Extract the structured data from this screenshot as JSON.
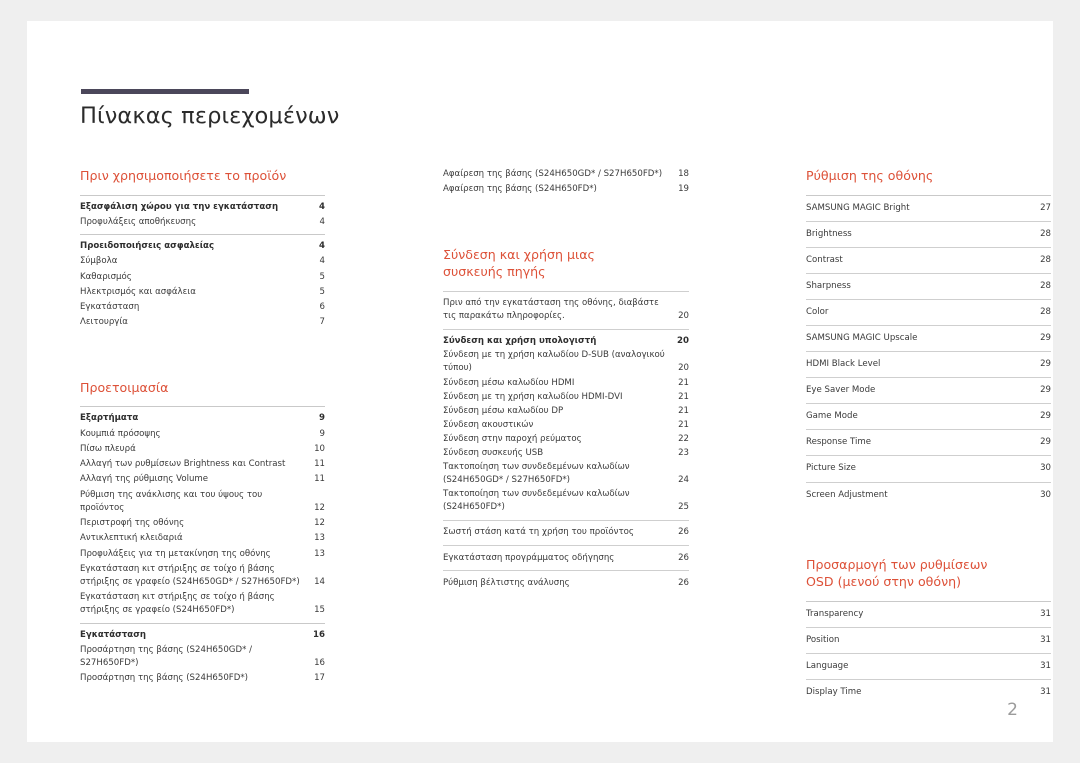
{
  "document": {
    "title": "Πίνακας περιεχομένων",
    "page_number": "2",
    "accent_color": "#dd5138",
    "rule_color": "#4b475a"
  },
  "columns": [
    {
      "id": "column-1",
      "sections": [
        {
          "heading": "Πριν χρησιμοποιήσετε το προϊόν",
          "groups": [
            {
              "style": "plain",
              "rows": [
                {
                  "label": "Εξασφάλιση χώρου για την εγκατάσταση",
                  "page": "4",
                  "bold": true
                },
                {
                  "label": "Προφυλάξεις αποθήκευσης",
                  "page": "4",
                  "bold": false
                }
              ]
            },
            {
              "style": "plain",
              "rows": [
                {
                  "label": "Προειδοποιήσεις ασφαλείας",
                  "page": "4",
                  "bold": true
                },
                {
                  "label": "Σύμβολα",
                  "page": "4",
                  "bold": false
                },
                {
                  "label": "Καθαρισμός",
                  "page": "5",
                  "bold": false
                },
                {
                  "label": "Ηλεκτρισμός και ασφάλεια",
                  "page": "5",
                  "bold": false
                },
                {
                  "label": "Εγκατάσταση",
                  "page": "6",
                  "bold": false
                },
                {
                  "label": "Λειτουργία",
                  "page": "7",
                  "bold": false
                }
              ]
            }
          ]
        },
        {
          "heading": "Προετοιμασία",
          "groups": [
            {
              "style": "plain",
              "rows": [
                {
                  "label": "Εξαρτήματα",
                  "page": "9",
                  "bold": true
                },
                {
                  "label": "Κουμπιά πρόσοψης",
                  "page": "9",
                  "bold": false
                },
                {
                  "label": "Πίσω πλευρά",
                  "page": "10",
                  "bold": false
                },
                {
                  "label": "Αλλαγή των ρυθμίσεων Brightness και Contrast",
                  "page": "11",
                  "bold": false
                },
                {
                  "label": "Αλλαγή της ρύθμισης Volume",
                  "page": "11",
                  "bold": false
                },
                {
                  "label": "Ρύθμιση της ανάκλισης και του ύψους του προϊόντος",
                  "page": "12",
                  "bold": false
                },
                {
                  "label": "Περιστροφή της οθόνης",
                  "page": "12",
                  "bold": false
                },
                {
                  "label": "Αντικλεπτική κλειδαριά",
                  "page": "13",
                  "bold": false
                },
                {
                  "label": "Προφυλάξεις για τη μετακίνηση της οθόνης",
                  "page": "13",
                  "bold": false
                },
                {
                  "label": "Εγκατάσταση κιτ στήριξης σε τοίχο ή βάσης στήριξης σε γραφείο (S24H650GD* / S27H650FD*)",
                  "page": "14",
                  "bold": false
                },
                {
                  "label": "Εγκατάσταση κιτ στήριξης σε τοίχο ή βάσης στήριξης σε γραφείο (S24H650FD*)",
                  "page": "15",
                  "bold": false
                }
              ]
            },
            {
              "style": "plain",
              "rows": [
                {
                  "label": "Εγκατάσταση",
                  "page": "16",
                  "bold": true
                },
                {
                  "label": "Προσάρτηση της βάσης (S24H650GD* / S27H650FD*)",
                  "page": "16",
                  "bold": false
                },
                {
                  "label": "Προσάρτηση της βάσης (S24H650FD*)",
                  "page": "17",
                  "bold": false
                }
              ]
            }
          ]
        }
      ]
    },
    {
      "id": "column-2",
      "sections": [
        {
          "heading": "",
          "groups": [
            {
              "style": "continuation",
              "rows": [
                {
                  "label": "Αφαίρεση της βάσης (S24H650GD* / S27H650FD*)",
                  "page": "18",
                  "bold": false
                },
                {
                  "label": "Αφαίρεση της βάσης (S24H650FD*)",
                  "page": "19",
                  "bold": false
                }
              ]
            }
          ]
        },
        {
          "heading": "Σύνδεση και χρήση μιας\nσυσκευής πηγής",
          "groups": [
            {
              "style": "block",
              "rows": [
                {
                  "label": "Πριν από την εγκατάσταση της οθόνης, διαβάστε τις παρακάτω πληροφορίες.",
                  "page": "20",
                  "bold": false
                }
              ]
            },
            {
              "style": "block",
              "rows": [
                {
                  "label": "Σύνδεση και χρήση υπολογιστή",
                  "page": "20",
                  "bold": true
                },
                {
                  "label": "Σύνδεση με τη χρήση καλωδίου D-SUB (αναλογικού τύπου)",
                  "page": "20",
                  "bold": false
                },
                {
                  "label": "Σύνδεση μέσω καλωδίου HDMI",
                  "page": "21",
                  "bold": false
                },
                {
                  "label": "Σύνδεση με τη χρήση καλωδίου HDMI-DVI",
                  "page": "21",
                  "bold": false
                },
                {
                  "label": "Σύνδεση μέσω καλωδίου DP",
                  "page": "21",
                  "bold": false
                },
                {
                  "label": "Σύνδεση ακουστικών",
                  "page": "21",
                  "bold": false
                },
                {
                  "label": "Σύνδεση στην παροχή ρεύματος",
                  "page": "22",
                  "bold": false
                },
                {
                  "label": "Σύνδεση συσκευής USB",
                  "page": "23",
                  "bold": false
                },
                {
                  "label": "Τακτοποίηση των συνδεδεμένων καλωδίων (S24H650GD* / S27H650FD*)",
                  "page": "24",
                  "bold": false
                },
                {
                  "label": "Τακτοποίηση των συνδεδεμένων καλωδίων (S24H650FD*)",
                  "page": "25",
                  "bold": false
                }
              ]
            },
            {
              "style": "block",
              "rows": [
                {
                  "label": "Σωστή στάση κατά τη χρήση του προϊόντος",
                  "page": "26",
                  "bold": false
                }
              ]
            },
            {
              "style": "block",
              "rows": [
                {
                  "label": "Εγκατάσταση προγράμματος οδήγησης",
                  "page": "26",
                  "bold": false
                }
              ]
            },
            {
              "style": "block",
              "rows": [
                {
                  "label": "Ρύθμιση βέλτιστης ανάλυσης",
                  "page": "26",
                  "bold": false
                }
              ]
            }
          ]
        }
      ]
    },
    {
      "id": "column-3",
      "sections": [
        {
          "heading": "Ρύθμιση της οθόνης",
          "groups": [
            {
              "style": "ruled",
              "rows": [
                {
                  "label": "SAMSUNG MAGIC Bright",
                  "page": "27",
                  "bold": false
                },
                {
                  "label": "Brightness",
                  "page": "28",
                  "bold": false
                },
                {
                  "label": "Contrast",
                  "page": "28",
                  "bold": false
                },
                {
                  "label": "Sharpness",
                  "page": "28",
                  "bold": false
                },
                {
                  "label": "Color",
                  "page": "28",
                  "bold": false
                },
                {
                  "label": "SAMSUNG MAGIC Upscale",
                  "page": "29",
                  "bold": false
                },
                {
                  "label": "HDMI Black Level",
                  "page": "29",
                  "bold": false
                },
                {
                  "label": "Eye Saver Mode",
                  "page": "29",
                  "bold": false
                },
                {
                  "label": "Game Mode",
                  "page": "29",
                  "bold": false
                },
                {
                  "label": "Response Time",
                  "page": "29",
                  "bold": false
                },
                {
                  "label": "Picture Size",
                  "page": "30",
                  "bold": false
                },
                {
                  "label": "Screen Adjustment",
                  "page": "30",
                  "bold": false
                }
              ]
            }
          ]
        },
        {
          "heading": "Προσαρμογή των ρυθμίσεων\nOSD (μενού στην οθόνη)",
          "groups": [
            {
              "style": "ruled",
              "rows": [
                {
                  "label": "Transparency",
                  "page": "31",
                  "bold": false
                },
                {
                  "label": "Position",
                  "page": "31",
                  "bold": false
                },
                {
                  "label": "Language",
                  "page": "31",
                  "bold": false
                },
                {
                  "label": "Display Time",
                  "page": "31",
                  "bold": false
                }
              ]
            }
          ]
        }
      ]
    }
  ]
}
